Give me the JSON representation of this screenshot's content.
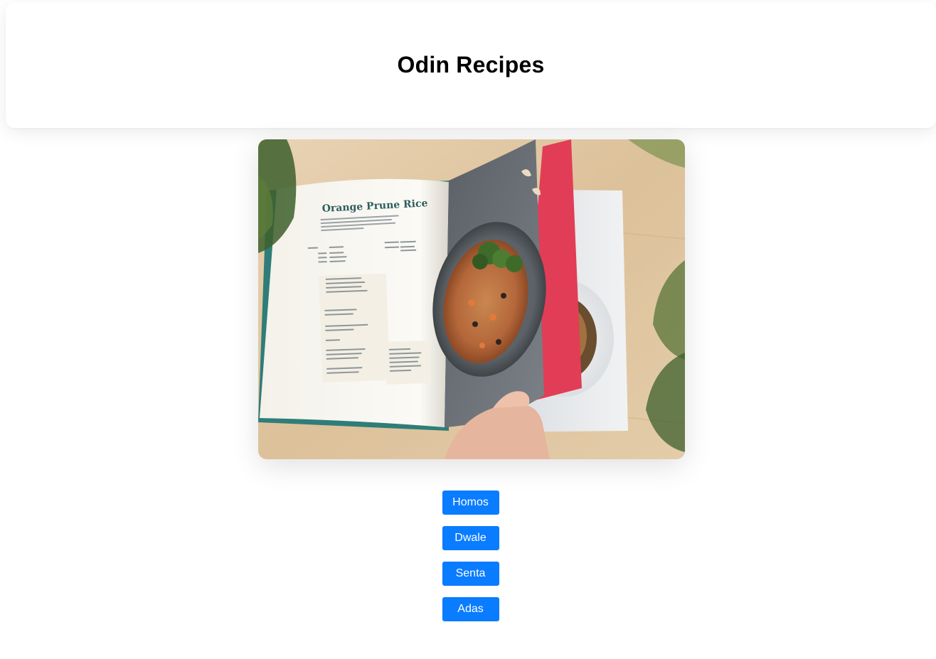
{
  "header": {
    "title": "Odin Recipes"
  },
  "hero": {
    "icon": "cookbook-photo",
    "book_heading": "Orange Prune Rice"
  },
  "recipes": [
    {
      "label": "Homos"
    },
    {
      "label": "Dwale"
    },
    {
      "label": "Senta"
    },
    {
      "label": "Adas"
    }
  ],
  "colors": {
    "button_bg": "#0a7cff",
    "button_text": "#ffffff",
    "title": "#000000"
  }
}
